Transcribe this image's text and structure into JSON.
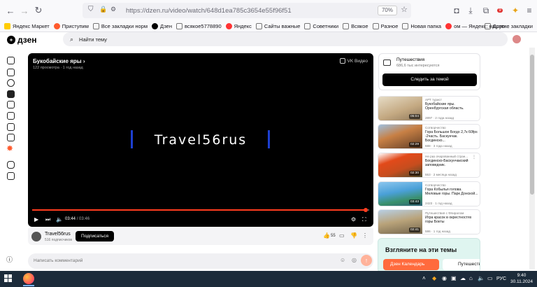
{
  "browser": {
    "url": "https://dzen.ru/video/watch/648d1ea785c3654e55f96f51",
    "zoom": "70%",
    "extension_badge": "9"
  },
  "bookmarks": [
    {
      "label": "Яндекс Маркет",
      "color": "#ffcc00"
    },
    {
      "label": "Приступим",
      "color": "#ff5a2d"
    },
    {
      "label": "Все закладки норм",
      "color": "#9aa0a6"
    },
    {
      "label": "Дзен",
      "color": "#000000"
    },
    {
      "label": "всякое5778890",
      "color": "#9aa0a6"
    },
    {
      "label": "Яндекс",
      "color": "#ff3333"
    },
    {
      "label": "Сайты важные",
      "color": "#9aa0a6"
    },
    {
      "label": "Советники",
      "color": "#9aa0a6"
    },
    {
      "label": "Всякое",
      "color": "#9aa0a6"
    },
    {
      "label": "Разное",
      "color": "#9aa0a6"
    },
    {
      "label": "Новая папка",
      "color": "#9aa0a6"
    },
    {
      "label": "ом — Яндекс: нашло...",
      "color": "#ff3333"
    }
  ],
  "bookmarks_other": "Другие закладки",
  "dzen": {
    "logo_text": "дзен",
    "search_placeholder": "Найти тему"
  },
  "video": {
    "title": "Букобайские яры",
    "meta": "122 просмотра · 1 год назад",
    "provider": "VK Видео",
    "overlay_text": "Travel56rus",
    "time_current": "03:44",
    "time_total": "/ 03:46",
    "progress_percent": 99
  },
  "channel": {
    "name": "Travel56rus",
    "subscribers": "516 подписчиков",
    "subscribe_label": "Подписаться",
    "likes": "55"
  },
  "comment": {
    "placeholder": "Написать комментарий"
  },
  "topic": {
    "title": "Путешествия",
    "subtitle": "686,6 тыс интересуются",
    "follow_label": "Следить за темой"
  },
  "recommendations": [
    {
      "source": "АРТ турист",
      "title": "Букобайские яры. Оренбургская область.",
      "stats": "2897 · 2 года назад",
      "duration": "05:04",
      "thumb_colors": [
        "#d9c9a8",
        "#8a7458"
      ]
    },
    {
      "source": "Сотворчество",
      "title": "Гора Большое Богдо 2,7к 60fps -2часть. Баскунчак. Богдинско...",
      "stats": "688 · 3 года назад",
      "duration": "02:29",
      "thumb_colors": [
        "#c88045",
        "#5a3a24"
      ]
    },
    {
      "source": "Не раз очарованный стран...",
      "title": "Богдинско-Баскунчакский заповедник.",
      "stats": "553 · 2 месяца назад",
      "duration": "02:30",
      "thumb_colors": [
        "#c64d1e",
        "#3f4a2a"
      ]
    },
    {
      "source": "Сотворчество",
      "title": "Гора Кобылья голова. Меловые горы. Парк Донской...",
      "stats": "2423 · 1 год назад",
      "duration": "03:43",
      "thumb_colors": [
        "#4aa0d8",
        "#2d5c7a"
      ]
    },
    {
      "source": "Путешествия с Флиралом",
      "title": "Игра красок в окрестностях горы Бокты",
      "stats": "586 · 1 год назад",
      "duration": "02:41",
      "thumb_colors": [
        "#b9a37a",
        "#6d6049"
      ]
    }
  ],
  "promo": {
    "title": "Взгляните на эти темы",
    "button1": "Дзен Календарь",
    "button2": "Путешеств"
  },
  "taskbar": {
    "language": "РУС",
    "time": "9:40",
    "date": "30.11.2024"
  }
}
